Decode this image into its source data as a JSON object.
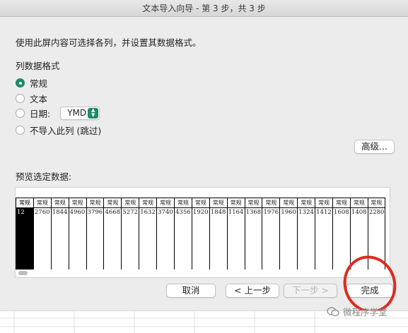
{
  "window": {
    "title": "文本导入向导 - 第 3 步，共 3 步"
  },
  "instruction": "使用此屏内容可选择各列，并设置其数据格式。",
  "column_format": {
    "label": "列数据格式",
    "options": [
      {
        "label": "常规",
        "checked": true
      },
      {
        "label": "文本",
        "checked": false
      },
      {
        "label": "日期:",
        "checked": false
      },
      {
        "label": "不导入此列 (跳过)",
        "checked": false
      }
    ],
    "date_format": "YMD"
  },
  "buttons": {
    "advanced": "高级...",
    "cancel": "取消",
    "back": "< 上一步",
    "next": "下一步 >",
    "finish": "完成"
  },
  "preview": {
    "label": "预览选定数据:",
    "headers": [
      "常规",
      "常规",
      "常规",
      "常规",
      "常规",
      "常规",
      "常规",
      "常规",
      "常规",
      "常规",
      "常规",
      "常规",
      "常规",
      "常规",
      "常规",
      "常规",
      "常规",
      "常规",
      "常规",
      "常规",
      "常规"
    ],
    "values": [
      "12",
      "2760",
      "1844",
      "4960",
      "3796",
      "4668",
      "5272",
      "1632",
      "3740",
      "4356",
      "1920",
      "1848",
      "1164",
      "1368",
      "1976",
      "1960",
      "1324",
      "1412",
      "1608",
      "1408",
      "2280"
    ]
  },
  "watermark": "微程序学堂",
  "colors": {
    "accent": "#1f8a6b",
    "annotation": "#e02a1f"
  }
}
